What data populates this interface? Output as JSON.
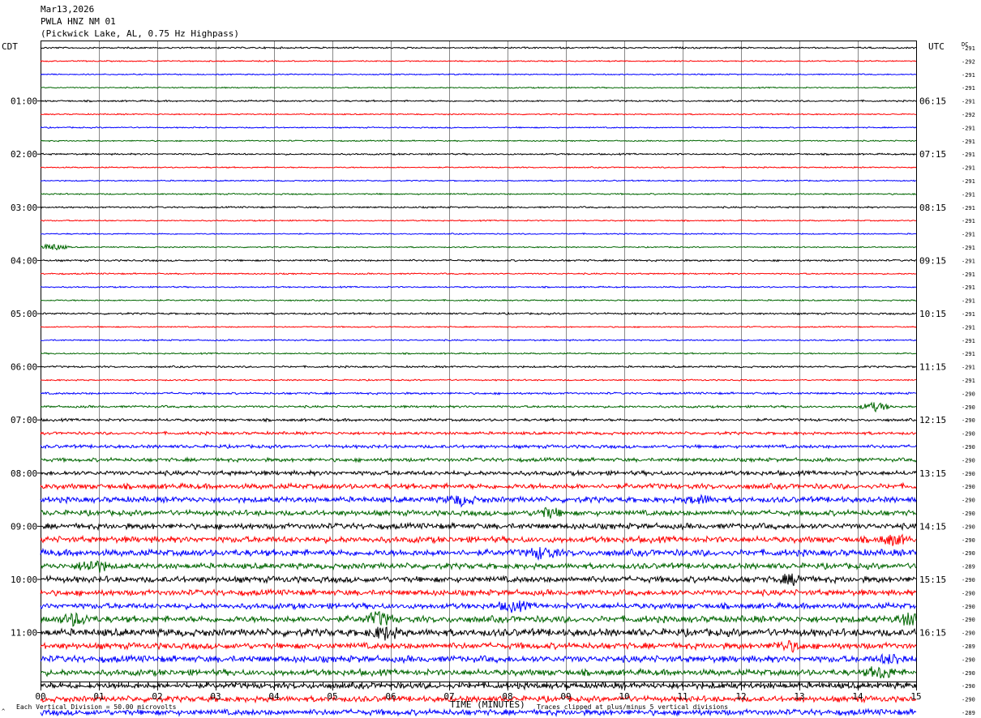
{
  "header": {
    "date": "Mar13,2026",
    "station": "PWLA HNZ NM 01",
    "location": "(Pickwick Lake, AL, 0.75 Hz Highpass)"
  },
  "axis_labels": {
    "left_tz": "CDT",
    "right_tz": "UTC",
    "dc_label": "DC",
    "xlabel": "TIME (MINUTES)"
  },
  "footer": {
    "scale_note": "Each Vertical Division =   50.00 microvolts",
    "clip_note": "Traces clipped at plus/minus 5 vertical divisions",
    "corner_mark": "^"
  },
  "colors": {
    "trace_cycle": [
      "#000000",
      "#ff0000",
      "#0000ff",
      "#006600"
    ],
    "grid": "#888888",
    "frame": "#000000"
  },
  "chart_data": {
    "type": "line",
    "title": "PWLA HNZ NM 01",
    "xlabel": "TIME (MINUTES)",
    "xlim": [
      0,
      15
    ],
    "x_ticks": [
      "00",
      "01",
      "02",
      "03",
      "04",
      "05",
      "06",
      "07",
      "08",
      "09",
      "10",
      "11",
      "12",
      "13",
      "14",
      "15"
    ],
    "rows_per_hour": 4,
    "minutes_per_row": 15,
    "left_time_labels": [
      "01:00",
      "02:00",
      "03:00",
      "04:00",
      "05:00",
      "06:00",
      "07:00",
      "08:00",
      "09:00",
      "10:00",
      "11:00"
    ],
    "right_time_labels": [
      "06:15",
      "07:15",
      "08:15",
      "09:15",
      "10:15",
      "11:15",
      "12:15",
      "13:15",
      "14:15",
      "15:15",
      "16:15"
    ],
    "dc_offsets": [
      "-291",
      "-292",
      "-291",
      "-291",
      "-291",
      "-292",
      "-291",
      "-291",
      "-291",
      "-291",
      "-291",
      "-291",
      "-291",
      "-291",
      "-291",
      "-291",
      "-291",
      "-291",
      "-291",
      "-291",
      "-291",
      "-291",
      "-291",
      "-291",
      "-291",
      "-291",
      "-290",
      "-290",
      "-290",
      "-290",
      "-290",
      "-290",
      "-290",
      "-290",
      "-290",
      "-290",
      "-290",
      "-290",
      "-290",
      "-289",
      "-290",
      "-290",
      "-290",
      "-290",
      "-290",
      "-289",
      "-290",
      "-290",
      "-290",
      "-290",
      "-289",
      "-289"
    ],
    "amplitude": [
      0.8,
      0.6,
      0.6,
      0.6,
      0.8,
      0.6,
      0.6,
      0.6,
      0.8,
      0.6,
      0.6,
      0.7,
      0.8,
      0.6,
      0.6,
      0.6,
      0.9,
      0.7,
      0.7,
      0.7,
      0.9,
      0.6,
      0.7,
      0.7,
      0.9,
      0.7,
      1.0,
      1.1,
      1.3,
      1.4,
      1.6,
      1.8,
      2.2,
      2.6,
      2.8,
      2.6,
      2.8,
      3.0,
      3.2,
      2.8,
      3.0,
      2.8,
      2.8,
      3.2,
      3.6,
      3.0,
      3.2,
      3.0,
      2.8,
      2.8,
      2.8,
      2.8
    ],
    "events": [
      {
        "row": 15,
        "minute": 0.2,
        "size": 4
      },
      {
        "row": 27,
        "minute": 14.3,
        "size": 5
      },
      {
        "row": 34,
        "minute": 7.2,
        "size": 5
      },
      {
        "row": 34,
        "minute": 11.3,
        "size": 4
      },
      {
        "row": 35,
        "minute": 8.7,
        "size": 5
      },
      {
        "row": 37,
        "minute": 14.6,
        "size": 5
      },
      {
        "row": 38,
        "minute": 8.6,
        "size": 6
      },
      {
        "row": 39,
        "minute": 0.9,
        "size": 7
      },
      {
        "row": 40,
        "minute": 12.9,
        "size": 5
      },
      {
        "row": 42,
        "minute": 8.1,
        "size": 5
      },
      {
        "row": 43,
        "minute": 0.6,
        "size": 6
      },
      {
        "row": 43,
        "minute": 5.8,
        "size": 7
      },
      {
        "row": 43,
        "minute": 14.9,
        "size": 6
      },
      {
        "row": 44,
        "minute": 5.9,
        "size": 6
      },
      {
        "row": 45,
        "minute": 12.8,
        "size": 5
      },
      {
        "row": 46,
        "minute": 14.6,
        "size": 5
      },
      {
        "row": 47,
        "minute": 14.4,
        "size": 6
      }
    ]
  }
}
